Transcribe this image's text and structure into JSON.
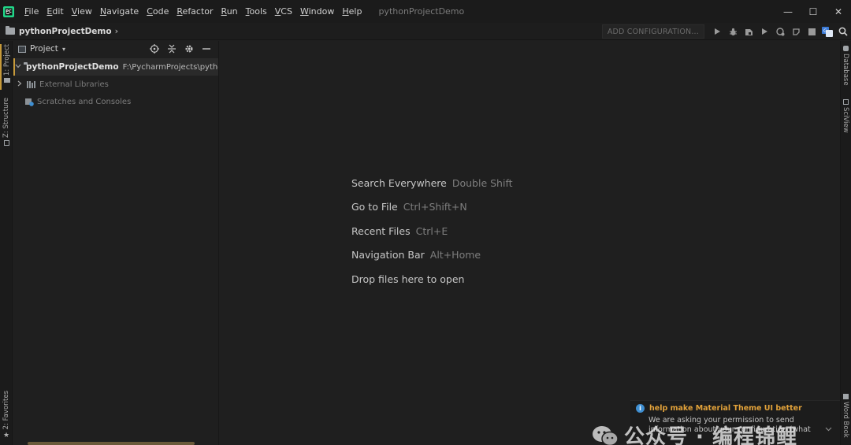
{
  "titlebar": {
    "menu": [
      "File",
      "Edit",
      "View",
      "Navigate",
      "Code",
      "Refactor",
      "Run",
      "Tools",
      "VCS",
      "Window",
      "Help"
    ],
    "window_title": "pythonProjectDemo",
    "controls": {
      "minimize": "—",
      "maximize": "☐",
      "close": "✕"
    }
  },
  "navbar": {
    "breadcrumb": "pythonProjectDemo",
    "chevron": "›",
    "add_configuration": "ADD CONFIGURATION...",
    "icons": [
      "run-icon",
      "debug-icon",
      "coverage-icon",
      "profile-icon",
      "concurrency-icon",
      "rerun-icon",
      "stop-icon",
      "translate-icon",
      "search-icon"
    ]
  },
  "left_stripe": {
    "project_tab": "1: Project",
    "structure_tab": "Z: Structure",
    "favorites_tab": "2: Favorites"
  },
  "right_stripe": {
    "database_tab": "Database",
    "sciview_tab": "SciView",
    "wordbook_tab": "Word Book"
  },
  "project_panel": {
    "title": "Project",
    "dropdown": "▾",
    "tree": {
      "root_name": "pythonProjectDemo",
      "root_path": "F:\\PycharmProjects\\pythonP",
      "external_libraries": "External Libraries",
      "scratches": "Scratches and Consoles"
    }
  },
  "editor": {
    "hints": [
      {
        "action": "Search Everywhere",
        "key": "Double Shift"
      },
      {
        "action": "Go to File",
        "key": "Ctrl+Shift+N"
      },
      {
        "action": "Recent Files",
        "key": "Ctrl+E"
      },
      {
        "action": "Navigation Bar",
        "key": "Alt+Home"
      },
      {
        "action": "Drop files here to open",
        "key": ""
      }
    ]
  },
  "notification": {
    "title": "help make Material Theme UI better",
    "body": "We are asking your permission to send information about your configuration (what"
  },
  "watermark": {
    "text": "公众号 · 编程锦鲤"
  },
  "colors": {
    "accent": "#c79a3a",
    "notification_title": "#e2a23a",
    "info": "#3f8fd2",
    "background": "#1f1f1f"
  }
}
